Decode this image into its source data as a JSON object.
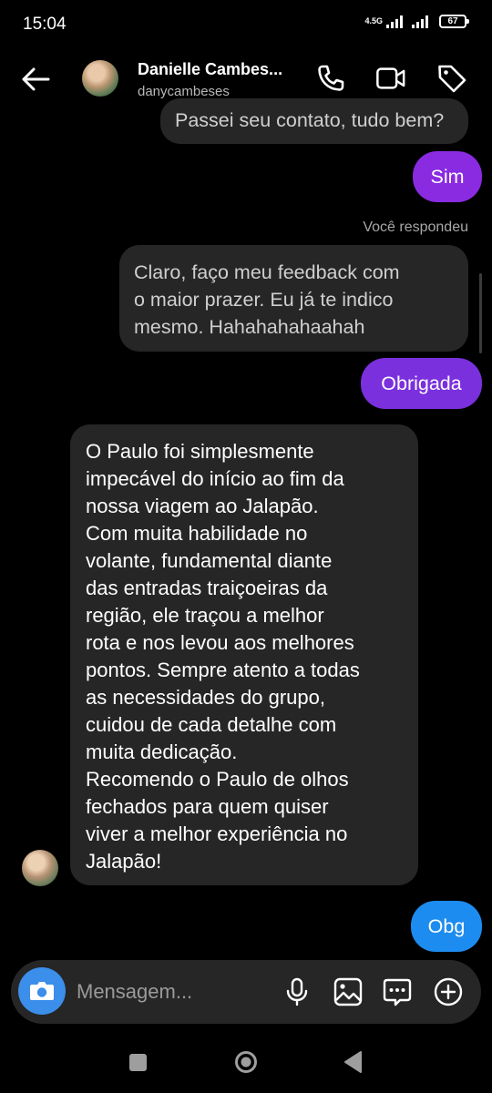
{
  "status": {
    "time": "15:04",
    "network": "4.5G",
    "battery": "67"
  },
  "header": {
    "name": "Danielle Cambes...",
    "username": "danycambeses"
  },
  "messages": {
    "m1": "Passei seu contato, tudo bem?",
    "m2": "Sim",
    "replied_label": "Você respondeu",
    "m3_lines": [
      "Claro, faço meu feedback com",
      "o maior prazer. Eu já te indico",
      "mesmo. Hahahahahaahah"
    ],
    "m4": "Obrigada",
    "m5_lines": [
      "O Paulo foi simplesmente",
      "impecável do início ao fim da",
      "nossa viagem ao Jalapão.",
      "Com muita habilidade no",
      "volante, fundamental diante",
      "das entradas traiçoeiras da",
      "região, ele traçou a melhor",
      "rota e nos levou aos melhores",
      "pontos. Sempre atento a todas",
      "as necessidades do grupo,",
      "cuidou de cada detalhe com",
      "muita dedicação.",
      "Recomendo o Paulo de olhos",
      "fechados para quem quiser",
      "viver a melhor experiência no",
      "Jalapão!"
    ],
    "m6": "Obg"
  },
  "composer": {
    "placeholder": "Mensagem..."
  },
  "colors": {
    "sent_purple": "#8a2be2",
    "sent_blue": "#1d8cf0",
    "camera_blue": "#3b8eea"
  }
}
